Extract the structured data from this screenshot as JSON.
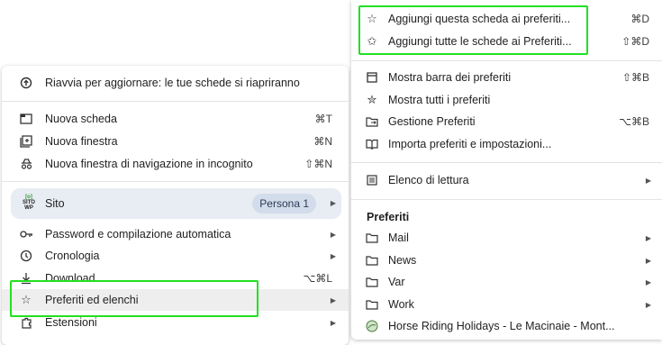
{
  "main_menu": {
    "restart": {
      "label": "Riavvia per aggiornare: le tue schede si riapriranno",
      "icon": "restart-icon"
    },
    "new_tab": {
      "label": "Nuova scheda",
      "shortcut": "⌘T",
      "icon": "new-tab-icon"
    },
    "new_window": {
      "label": "Nuova finestra",
      "shortcut": "⌘N",
      "icon": "new-window-icon"
    },
    "incognito": {
      "label": "Nuova finestra di navigazione in incognito",
      "shortcut": "⇧⌘N",
      "icon": "incognito-icon"
    },
    "profile": {
      "label": "Sito",
      "badge": "Persona 1",
      "logo_text": "SITO WP"
    },
    "passwords": {
      "label": "Password e compilazione automatica",
      "icon": "key-icon"
    },
    "history": {
      "label": "Cronologia",
      "icon": "history-icon"
    },
    "downloads": {
      "label": "Download",
      "shortcut": "⌥⌘L",
      "icon": "download-icon"
    },
    "bookmarks": {
      "label": "Preferiti ed elenchi",
      "icon": "star-icon"
    },
    "extensions": {
      "label": "Estensioni",
      "icon": "puzzle-icon"
    }
  },
  "sub_menu": {
    "bookmark_tab": {
      "label": "Aggiungi questa scheda ai preferiti...",
      "shortcut": "⌘D"
    },
    "bookmark_all": {
      "label": "Aggiungi tutte le schede ai Preferiti...",
      "shortcut": "⇧⌘D"
    },
    "show_bar": {
      "label": "Mostra barra dei preferiti",
      "shortcut": "⇧⌘B"
    },
    "show_all": {
      "label": "Mostra tutti i preferiti"
    },
    "manager": {
      "label": "Gestione Preferiti",
      "shortcut": "⌥⌘B"
    },
    "import": {
      "label": "Importa preferiti e impostazioni..."
    },
    "reading_list": {
      "label": "Elenco di lettura"
    },
    "section_title": "Preferiti",
    "folders": [
      {
        "label": "Mail"
      },
      {
        "label": "News"
      },
      {
        "label": "Var"
      },
      {
        "label": "Work"
      }
    ],
    "site": {
      "label": "Horse Riding Holidays - Le Macinaie - Mont..."
    }
  },
  "colors": {
    "highlight": "#22e022",
    "profile_bg": "#e8ecf3",
    "hover_bg": "#eeeeee"
  }
}
